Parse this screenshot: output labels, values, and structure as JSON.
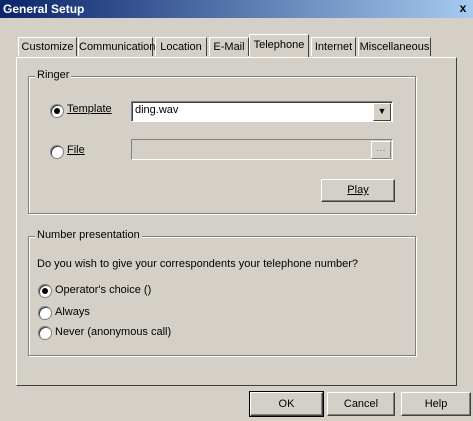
{
  "window": {
    "title": "General Setup",
    "close_label": "x"
  },
  "tabs": [
    {
      "label": "Customize"
    },
    {
      "label": "Communication"
    },
    {
      "label": "Location"
    },
    {
      "label": "E-Mail"
    },
    {
      "label": "Telephone"
    },
    {
      "label": "Internet"
    },
    {
      "label": "Miscellaneous"
    }
  ],
  "ringer": {
    "group_label": "Ringer",
    "template_label": "Template",
    "template_value": "ding.wav",
    "file_label": "File",
    "file_value": "",
    "browse_label": "...",
    "play_label": "Play"
  },
  "number_presentation": {
    "group_label": "Number presentation",
    "question": "Do you wish to give your correspondents your telephone number?",
    "options": [
      {
        "label": "Operator's choice ()"
      },
      {
        "label": "Always"
      },
      {
        "label": "Never (anonymous call)"
      }
    ]
  },
  "buttons": {
    "ok": "OK",
    "cancel": "Cancel",
    "help": "Help"
  }
}
